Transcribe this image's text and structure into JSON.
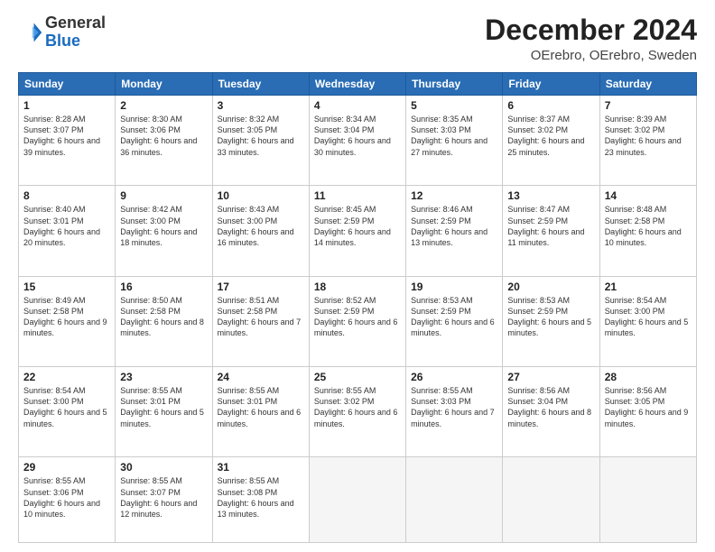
{
  "header": {
    "logo": {
      "general": "General",
      "blue": "Blue"
    },
    "title": "December 2024",
    "location": "OErebro, OErebro, Sweden"
  },
  "weekdays": [
    "Sunday",
    "Monday",
    "Tuesday",
    "Wednesday",
    "Thursday",
    "Friday",
    "Saturday"
  ],
  "weeks": [
    [
      {
        "day": 1,
        "sunrise": "8:28 AM",
        "sunset": "3:07 PM",
        "daylight": "6 hours and 39 minutes."
      },
      {
        "day": 2,
        "sunrise": "8:30 AM",
        "sunset": "3:06 PM",
        "daylight": "6 hours and 36 minutes."
      },
      {
        "day": 3,
        "sunrise": "8:32 AM",
        "sunset": "3:05 PM",
        "daylight": "6 hours and 33 minutes."
      },
      {
        "day": 4,
        "sunrise": "8:34 AM",
        "sunset": "3:04 PM",
        "daylight": "6 hours and 30 minutes."
      },
      {
        "day": 5,
        "sunrise": "8:35 AM",
        "sunset": "3:03 PM",
        "daylight": "6 hours and 27 minutes."
      },
      {
        "day": 6,
        "sunrise": "8:37 AM",
        "sunset": "3:02 PM",
        "daylight": "6 hours and 25 minutes."
      },
      {
        "day": 7,
        "sunrise": "8:39 AM",
        "sunset": "3:02 PM",
        "daylight": "6 hours and 23 minutes."
      }
    ],
    [
      {
        "day": 8,
        "sunrise": "8:40 AM",
        "sunset": "3:01 PM",
        "daylight": "6 hours and 20 minutes."
      },
      {
        "day": 9,
        "sunrise": "8:42 AM",
        "sunset": "3:00 PM",
        "daylight": "6 hours and 18 minutes."
      },
      {
        "day": 10,
        "sunrise": "8:43 AM",
        "sunset": "3:00 PM",
        "daylight": "6 hours and 16 minutes."
      },
      {
        "day": 11,
        "sunrise": "8:45 AM",
        "sunset": "2:59 PM",
        "daylight": "6 hours and 14 minutes."
      },
      {
        "day": 12,
        "sunrise": "8:46 AM",
        "sunset": "2:59 PM",
        "daylight": "6 hours and 13 minutes."
      },
      {
        "day": 13,
        "sunrise": "8:47 AM",
        "sunset": "2:59 PM",
        "daylight": "6 hours and 11 minutes."
      },
      {
        "day": 14,
        "sunrise": "8:48 AM",
        "sunset": "2:58 PM",
        "daylight": "6 hours and 10 minutes."
      }
    ],
    [
      {
        "day": 15,
        "sunrise": "8:49 AM",
        "sunset": "2:58 PM",
        "daylight": "6 hours and 9 minutes."
      },
      {
        "day": 16,
        "sunrise": "8:50 AM",
        "sunset": "2:58 PM",
        "daylight": "6 hours and 8 minutes."
      },
      {
        "day": 17,
        "sunrise": "8:51 AM",
        "sunset": "2:58 PM",
        "daylight": "6 hours and 7 minutes."
      },
      {
        "day": 18,
        "sunrise": "8:52 AM",
        "sunset": "2:59 PM",
        "daylight": "6 hours and 6 minutes."
      },
      {
        "day": 19,
        "sunrise": "8:53 AM",
        "sunset": "2:59 PM",
        "daylight": "6 hours and 6 minutes."
      },
      {
        "day": 20,
        "sunrise": "8:53 AM",
        "sunset": "2:59 PM",
        "daylight": "6 hours and 5 minutes."
      },
      {
        "day": 21,
        "sunrise": "8:54 AM",
        "sunset": "3:00 PM",
        "daylight": "6 hours and 5 minutes."
      }
    ],
    [
      {
        "day": 22,
        "sunrise": "8:54 AM",
        "sunset": "3:00 PM",
        "daylight": "6 hours and 5 minutes."
      },
      {
        "day": 23,
        "sunrise": "8:55 AM",
        "sunset": "3:01 PM",
        "daylight": "6 hours and 5 minutes."
      },
      {
        "day": 24,
        "sunrise": "8:55 AM",
        "sunset": "3:01 PM",
        "daylight": "6 hours and 6 minutes."
      },
      {
        "day": 25,
        "sunrise": "8:55 AM",
        "sunset": "3:02 PM",
        "daylight": "6 hours and 6 minutes."
      },
      {
        "day": 26,
        "sunrise": "8:55 AM",
        "sunset": "3:03 PM",
        "daylight": "6 hours and 7 minutes."
      },
      {
        "day": 27,
        "sunrise": "8:56 AM",
        "sunset": "3:04 PM",
        "daylight": "6 hours and 8 minutes."
      },
      {
        "day": 28,
        "sunrise": "8:56 AM",
        "sunset": "3:05 PM",
        "daylight": "6 hours and 9 minutes."
      }
    ],
    [
      {
        "day": 29,
        "sunrise": "8:55 AM",
        "sunset": "3:06 PM",
        "daylight": "6 hours and 10 minutes."
      },
      {
        "day": 30,
        "sunrise": "8:55 AM",
        "sunset": "3:07 PM",
        "daylight": "6 hours and 12 minutes."
      },
      {
        "day": 31,
        "sunrise": "8:55 AM",
        "sunset": "3:08 PM",
        "daylight": "6 hours and 13 minutes."
      },
      null,
      null,
      null,
      null
    ]
  ]
}
